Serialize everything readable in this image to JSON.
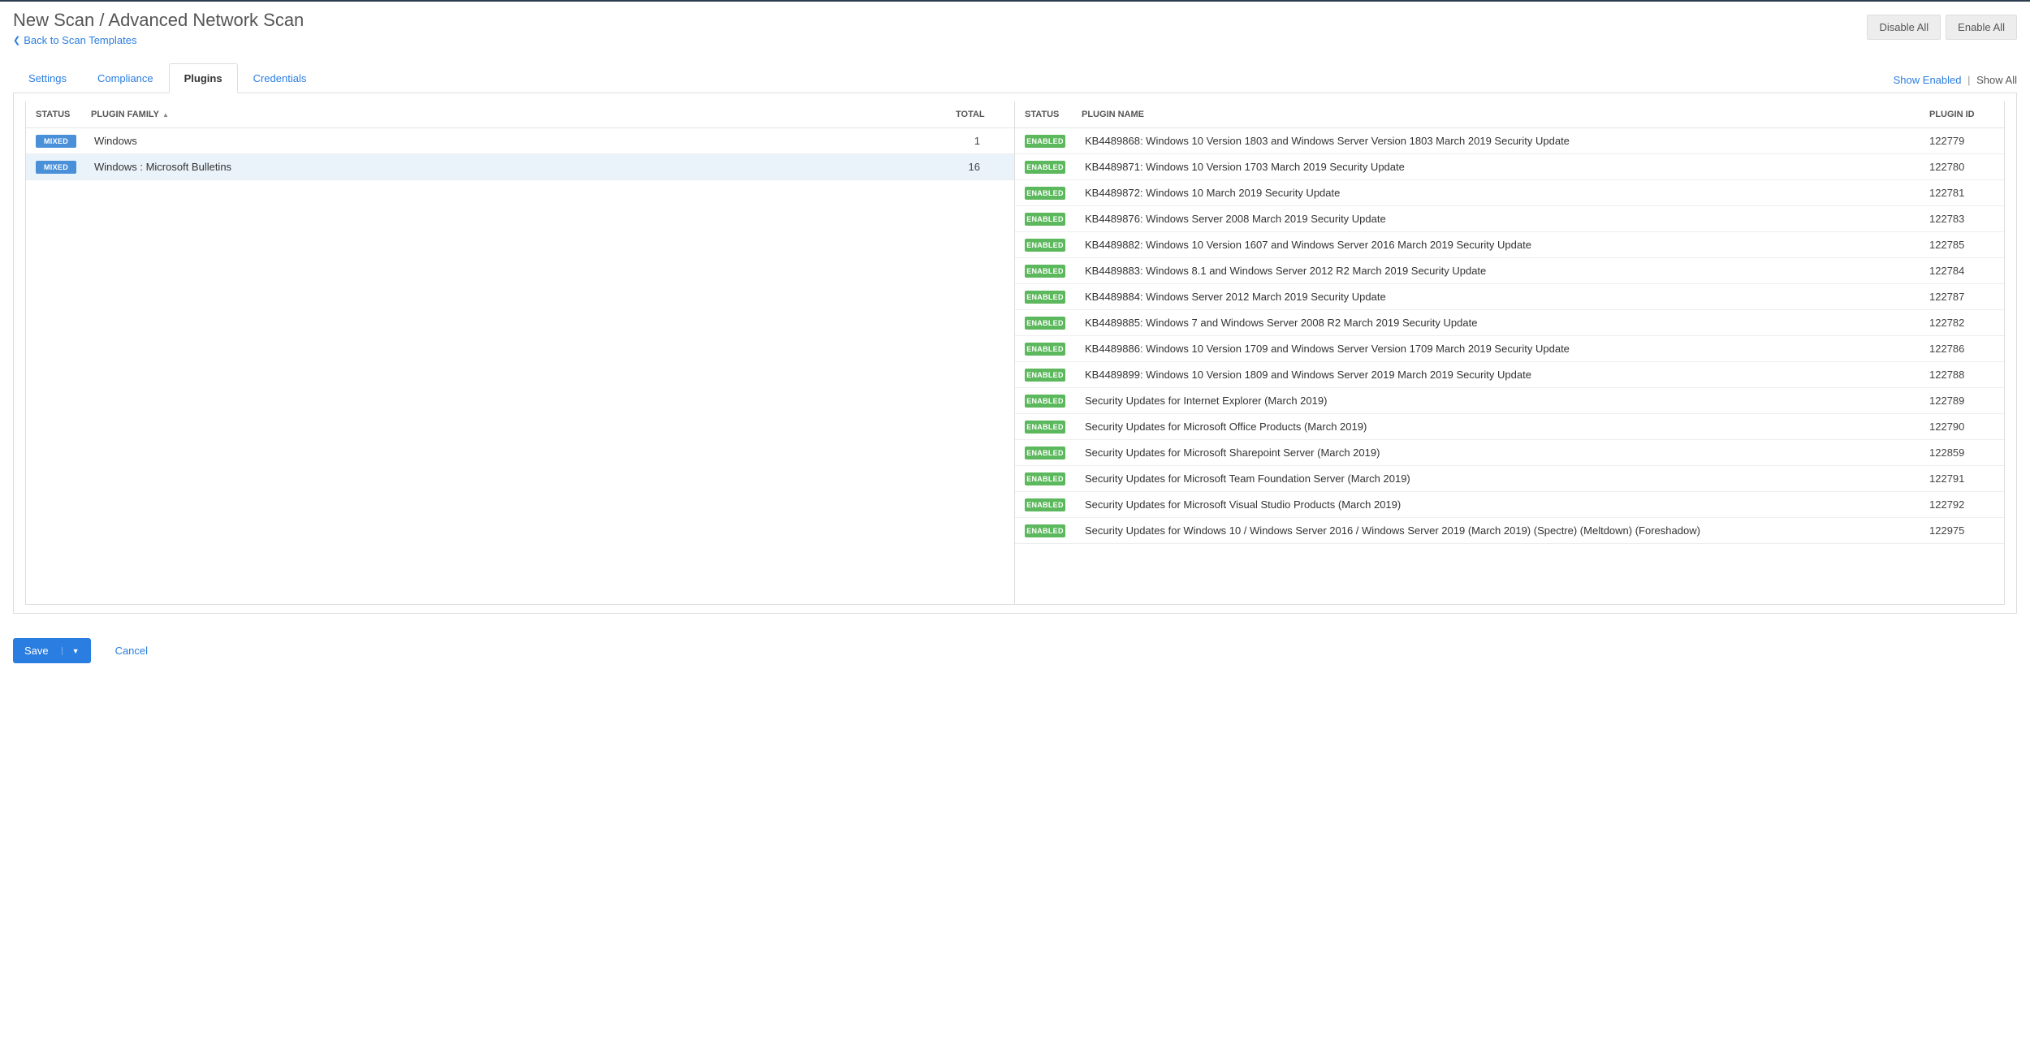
{
  "header": {
    "title": "New Scan / Advanced Network Scan",
    "back_label": "Back to Scan Templates",
    "disable_all": "Disable All",
    "enable_all": "Enable All"
  },
  "tabs": {
    "settings": "Settings",
    "compliance": "Compliance",
    "plugins": "Plugins",
    "credentials": "Credentials"
  },
  "filter": {
    "show_enabled": "Show Enabled",
    "show_all": "Show All"
  },
  "left_headers": {
    "status": "STATUS",
    "family": "PLUGIN FAMILY",
    "total": "TOTAL"
  },
  "right_headers": {
    "status": "STATUS",
    "name": "PLUGIN NAME",
    "id": "PLUGIN ID"
  },
  "families": [
    {
      "status": "MIXED",
      "name": "Windows",
      "total": "1",
      "selected": false
    },
    {
      "status": "MIXED",
      "name": "Windows : Microsoft Bulletins",
      "total": "16",
      "selected": true
    }
  ],
  "plugins": [
    {
      "status": "ENABLED",
      "name": "KB4489868: Windows 10 Version 1803 and Windows Server Version 1803 March 2019 Security Update",
      "id": "122779"
    },
    {
      "status": "ENABLED",
      "name": "KB4489871: Windows 10 Version 1703 March 2019 Security Update",
      "id": "122780"
    },
    {
      "status": "ENABLED",
      "name": "KB4489872: Windows 10 March 2019 Security Update",
      "id": "122781"
    },
    {
      "status": "ENABLED",
      "name": "KB4489876: Windows Server 2008 March 2019 Security Update",
      "id": "122783"
    },
    {
      "status": "ENABLED",
      "name": "KB4489882: Windows 10 Version 1607 and Windows Server 2016 March 2019 Security Update",
      "id": "122785"
    },
    {
      "status": "ENABLED",
      "name": "KB4489883: Windows 8.1 and Windows Server 2012 R2 March 2019 Security Update",
      "id": "122784"
    },
    {
      "status": "ENABLED",
      "name": "KB4489884: Windows Server 2012 March 2019 Security Update",
      "id": "122787"
    },
    {
      "status": "ENABLED",
      "name": "KB4489885: Windows 7 and Windows Server 2008 R2 March 2019 Security Update",
      "id": "122782"
    },
    {
      "status": "ENABLED",
      "name": "KB4489886: Windows 10 Version 1709 and Windows Server Version 1709 March 2019 Security Update",
      "id": "122786"
    },
    {
      "status": "ENABLED",
      "name": "KB4489899: Windows 10 Version 1809 and Windows Server 2019 March 2019 Security Update",
      "id": "122788"
    },
    {
      "status": "ENABLED",
      "name": "Security Updates for Internet Explorer (March 2019)",
      "id": "122789"
    },
    {
      "status": "ENABLED",
      "name": "Security Updates for Microsoft Office Products (March 2019)",
      "id": "122790"
    },
    {
      "status": "ENABLED",
      "name": "Security Updates for Microsoft Sharepoint Server (March 2019)",
      "id": "122859"
    },
    {
      "status": "ENABLED",
      "name": "Security Updates for Microsoft Team Foundation Server (March 2019)",
      "id": "122791"
    },
    {
      "status": "ENABLED",
      "name": "Security Updates for Microsoft Visual Studio Products (March 2019)",
      "id": "122792"
    },
    {
      "status": "ENABLED",
      "name": "Security Updates for Windows 10 / Windows Server 2016 / Windows Server 2019 (March 2019) (Spectre) (Meltdown) (Foreshadow)",
      "id": "122975"
    }
  ],
  "footer": {
    "save": "Save",
    "cancel": "Cancel"
  }
}
